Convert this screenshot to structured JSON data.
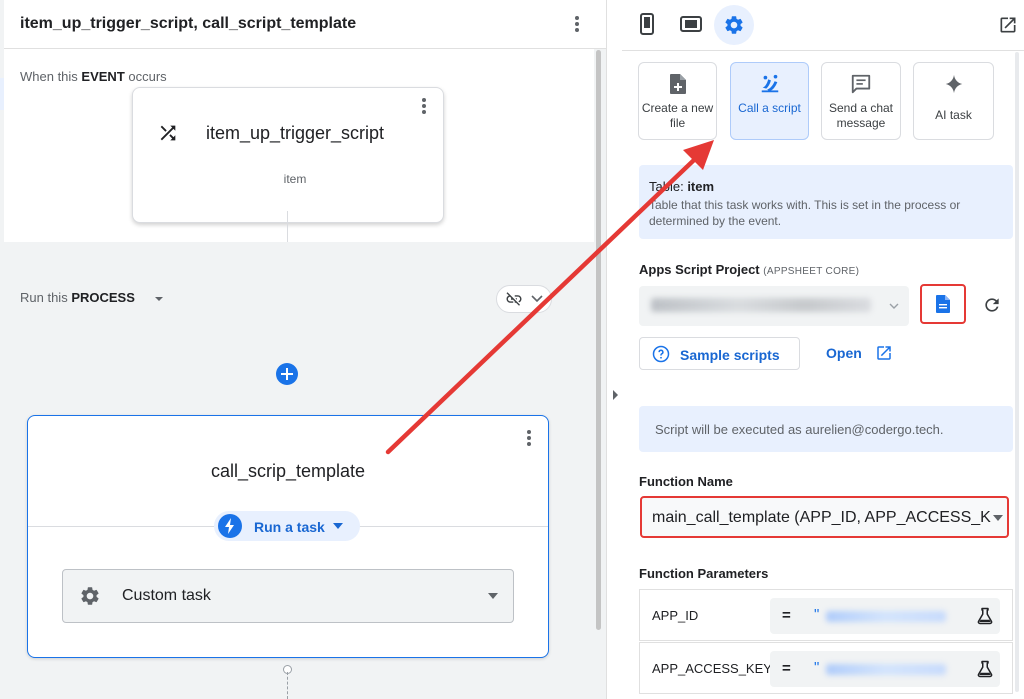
{
  "workflow": {
    "title": "item_up_trigger_script, call_script_template"
  },
  "event": {
    "label_prefix": "When this ",
    "label_bold": "EVENT",
    "label_suffix": " occurs",
    "card_name": "item_up_trigger_script",
    "card_table": "item"
  },
  "process": {
    "label_prefix": "Run this ",
    "label_bold": "PROCESS"
  },
  "task": {
    "name": "call_scrip_template",
    "run_button_label": "Run a task",
    "custom_task_label": "Custom task"
  },
  "toolbar": {
    "icons": [
      "phone-icon",
      "tablet-icon",
      "gear-icon",
      "open-in-new-icon"
    ]
  },
  "task_types": [
    {
      "label": "Create a new file",
      "icon": "note-add-icon"
    },
    {
      "label": "Call a script",
      "icon": "script-icon",
      "selected": true
    },
    {
      "label": "Send a chat message",
      "icon": "chat-icon"
    },
    {
      "label": "AI task",
      "icon": "sparkle-icon"
    }
  ],
  "table_info": {
    "label_prefix": "Table: ",
    "value": "item",
    "description": "Table that this task works with. This is set in the process or determined by the event."
  },
  "apps_script": {
    "label": "Apps Script Project",
    "sublabel": "(APPSHEET CORE)",
    "sample_label": "Sample scripts",
    "open_label": "Open"
  },
  "exec_note": "Script will be executed as aurelien@codergo.tech.",
  "function_name": {
    "label": "Function Name",
    "value": "main_call_template (APP_ID, APP_ACCESS_KEY)"
  },
  "function_params": {
    "label": "Function Parameters",
    "rows": [
      {
        "name": "APP_ID",
        "eq": "=",
        "quote": "\""
      },
      {
        "name": "APP_ACCESS_KEY",
        "eq": "=",
        "quote": "\""
      }
    ]
  },
  "colors": {
    "accent": "#1a73e8",
    "annotation_red": "#e53935",
    "info_background": "#e8f0fe"
  }
}
